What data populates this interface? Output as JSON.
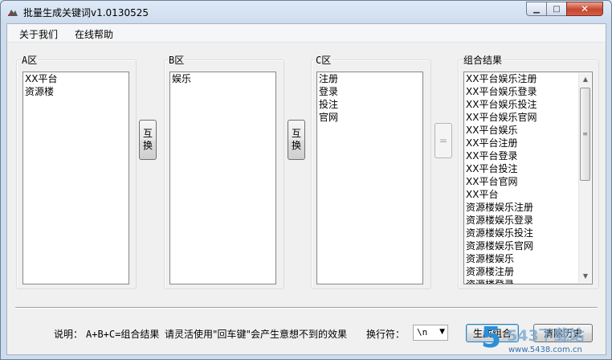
{
  "window": {
    "title": "批量生成关键词v1.0130525"
  },
  "caption": {
    "minimize": "▁",
    "maximize": "□",
    "close": "✕"
  },
  "menu": {
    "items": [
      "关于我们",
      "在线帮助"
    ]
  },
  "groups": {
    "a": {
      "label": "A区",
      "items": [
        "XX平台",
        "资源楼"
      ]
    },
    "b": {
      "label": "B区",
      "items": [
        "娱乐"
      ]
    },
    "c": {
      "label": "C区",
      "items": [
        "注册",
        "登录",
        "投注",
        "官网"
      ]
    },
    "result": {
      "label": "组合结果",
      "items": [
        "XX平台娱乐注册",
        "XX平台娱乐登录",
        "XX平台娱乐投注",
        "XX平台娱乐官网",
        "XX平台娱乐",
        "XX平台注册",
        "XX平台登录",
        "XX平台投注",
        "XX平台官网",
        "XX平台",
        "资源楼娱乐注册",
        "资源楼娱乐登录",
        "资源楼娱乐投注",
        "资源楼娱乐官网",
        "资源楼娱乐",
        "资源楼注册",
        "资源楼登录"
      ]
    }
  },
  "buttons": {
    "swap_ab": "互\n换",
    "swap_bc": "互\n换",
    "equals": "=",
    "generate": "生成组合",
    "clear": "清除历史"
  },
  "status": {
    "explain_label": "说明：",
    "formula": "A+B+C=组合结果",
    "tip": "请灵活使用\"回车键\"会产生意想不到的效果",
    "newline_label": "换行符："
  },
  "newline_select": {
    "value": "\\n"
  },
  "icons": {
    "scroll_up": "up-arrow-icon",
    "scroll_down": "down-arrow-icon"
  },
  "watermark": {
    "logo": "5",
    "text": "543下载站",
    "url": "www.5438.com.cn"
  }
}
